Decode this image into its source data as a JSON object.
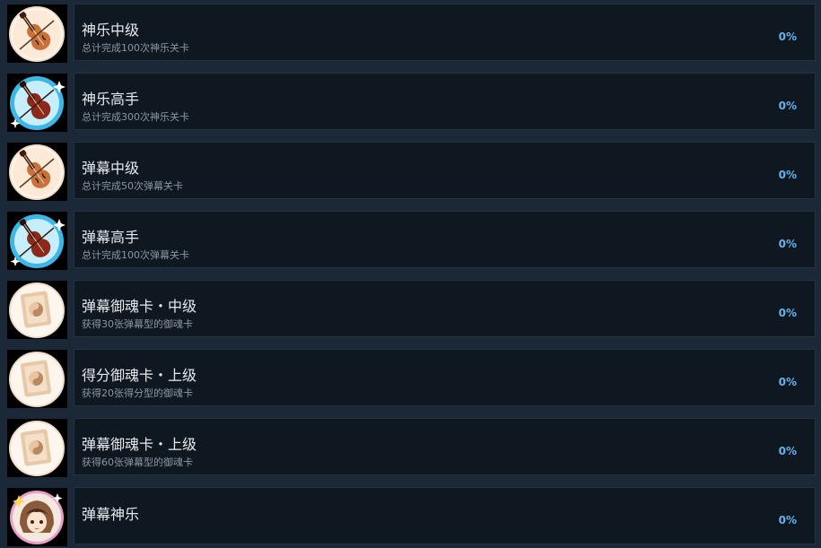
{
  "achievements": [
    {
      "title": "神乐中级",
      "description": "总计完成100次神乐关卡",
      "percent": "0%",
      "icon": "violin-icon",
      "badge_color": "#c9713a"
    },
    {
      "title": "神乐高手",
      "description": "总计完成300次神乐关卡",
      "percent": "0%",
      "icon": "violin-sparkle-icon",
      "badge_color": "#3db8e6"
    },
    {
      "title": "弹幕中级",
      "description": "总计完成50次弹幕关卡",
      "percent": "0%",
      "icon": "violin-icon",
      "badge_color": "#c9713a"
    },
    {
      "title": "弹幕高手",
      "description": "总计完成100次弹幕关卡",
      "percent": "0%",
      "icon": "violin-sparkle-icon",
      "badge_color": "#3db8e6"
    },
    {
      "title": "弹幕御魂卡・中级",
      "description": "获得30张弹幕型的御魂卡",
      "percent": "0%",
      "icon": "yin-yang-card-icon",
      "badge_color": "#e8c9a7"
    },
    {
      "title": "得分御魂卡・上级",
      "description": "获得20张得分型的御魂卡",
      "percent": "0%",
      "icon": "yin-yang-card-icon",
      "badge_color": "#e8c9a7"
    },
    {
      "title": "弹幕御魂卡・上级",
      "description": "获得60张弹幕型的御魂卡",
      "percent": "0%",
      "icon": "yin-yang-card-icon",
      "badge_color": "#e8c9a7"
    },
    {
      "title": "弹幕神乐",
      "description": "",
      "percent": "0%",
      "icon": "character-portrait-icon",
      "badge_color": "#8a5a3a"
    }
  ]
}
